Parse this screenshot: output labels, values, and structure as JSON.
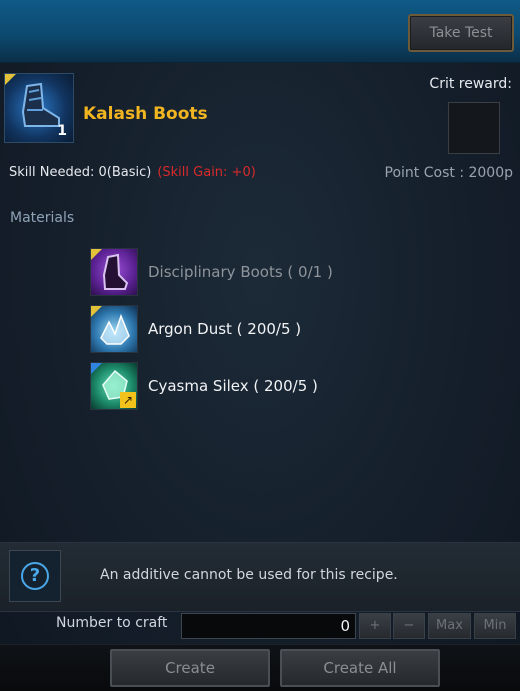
{
  "header": {
    "take_test_label": "Take Test"
  },
  "item": {
    "name": "Kalash Boots",
    "quantity": "1",
    "icon": "boots-icon",
    "crit_reward_label": "Crit reward:"
  },
  "skill": {
    "needed_text": "Skill Needed: 0(Basic)",
    "gain_text": "(Skill Gain:  +0)",
    "point_cost_text": "Point Cost  : 2000p"
  },
  "materials": {
    "label": "Materials",
    "items": [
      {
        "name": "Disciplinary Boots ( 0/1 )",
        "icon": "boots-icon",
        "available": false
      },
      {
        "name": "Argon Dust ( 200/5 )",
        "icon": "dust-crystal-icon",
        "available": true
      },
      {
        "name": "Cyasma Silex ( 200/5 )",
        "icon": "gem-icon",
        "available": true
      }
    ]
  },
  "info": {
    "text": "An additive cannot be used for this recipe."
  },
  "craft": {
    "label": "Number to craft",
    "value": "0",
    "plus": "+",
    "minus": "−",
    "max": "Max",
    "min": "Min"
  },
  "actions": {
    "create": "Create",
    "create_all": "Create All"
  },
  "colors": {
    "item_name": "#f0b520",
    "skill_gain": "#d82a2a",
    "accent_blue": "#4aa7e8",
    "top_band": "#0f5a86"
  }
}
